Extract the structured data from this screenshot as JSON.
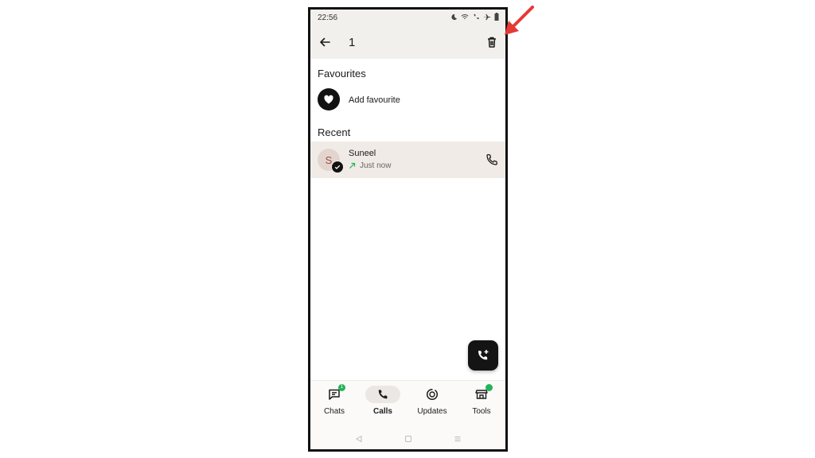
{
  "status_bar": {
    "time": "22:56"
  },
  "app_bar": {
    "selected_count": "1"
  },
  "favourites": {
    "heading": "Favourites",
    "add_label": "Add favourite"
  },
  "recent": {
    "heading": "Recent",
    "items": [
      {
        "initial": "S",
        "name": "Suneel",
        "time": "Just now",
        "direction": "outgoing"
      }
    ]
  },
  "bottom_nav": {
    "items": [
      {
        "label": "Chats",
        "badge": "1"
      },
      {
        "label": "Calls",
        "active": true
      },
      {
        "label": "Updates"
      },
      {
        "label": "Tools"
      }
    ]
  },
  "colors": {
    "accent_green": "#25b35a",
    "selection_bg": "#f0ebe6",
    "annotation_red": "#e53935"
  }
}
